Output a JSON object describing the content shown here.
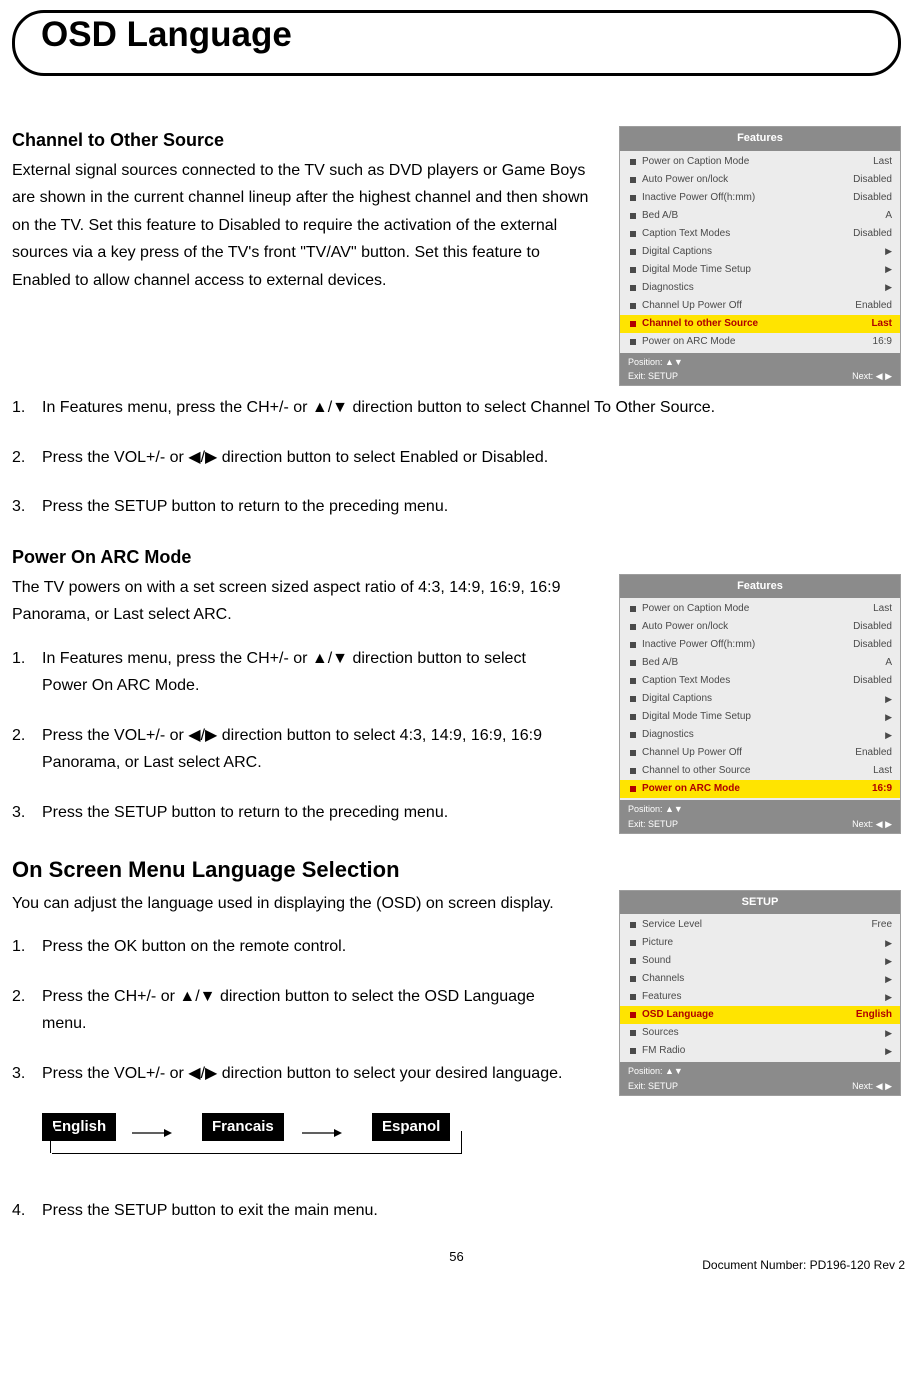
{
  "title": "OSD Language",
  "section1": {
    "heading": "Channel to Other Source",
    "para": "External signal sources connected to the TV such as DVD players or Game Boys are shown in the current channel lineup after the highest channel and then shown on the TV. Set this feature to Disabled to require the activation of the external sources via a key press of the TV's front \"TV/AV\" button. Set this feature to Enabled to allow channel access to external devices.",
    "steps": [
      "In Features menu, press the CH+/- or ▲/▼ direction button to select Channel To Other Source.",
      "Press the VOL+/- or ◀/▶ direction button to select Enabled or Disabled.",
      "Press the SETUP button to return to the preceding menu."
    ]
  },
  "section2": {
    "heading": "Power On ARC Mode",
    "para": "The TV powers on with a set screen sized aspect ratio of   4:3, 14:9, 16:9, 16:9 Panorama, or Last select ARC.",
    "steps": [
      "In Features menu, press the CH+/- or ▲/▼ direction button to select Power On ARC Mode.",
      "Press the VOL+/- or ◀/▶ direction button to select 4:3, 14:9, 16:9, 16:9 Panorama, or Last select ARC.",
      "Press the SETUP button to return to the preceding menu."
    ]
  },
  "section3": {
    "heading": "On Screen Menu Language Selection",
    "para": "You can adjust the language used in displaying the (OSD) on screen display.",
    "steps": [
      "Press the OK button on the remote control.",
      "Press the CH+/- or ▲/▼ direction button to select the OSD Language menu.",
      "Press the VOL+/- or ◀/▶ direction button to select your desired language.",
      "Press the SETUP button to exit the main menu."
    ]
  },
  "osd_features_1": {
    "header": "Features",
    "rows": [
      {
        "label": "Power on Caption Mode",
        "value": "Last",
        "hi": false
      },
      {
        "label": "Auto Power on/lock",
        "value": "Disabled",
        "hi": false
      },
      {
        "label": "Inactive Power Off(h:mm)",
        "value": "Disabled",
        "hi": false
      },
      {
        "label": "Bed A/B",
        "value": "A",
        "hi": false
      },
      {
        "label": "Caption Text Modes",
        "value": "Disabled",
        "hi": false
      },
      {
        "label": "Digital Captions",
        "value": "▶",
        "hi": false
      },
      {
        "label": "Digital Mode Time Setup",
        "value": "▶",
        "hi": false
      },
      {
        "label": "Diagnostics",
        "value": "▶",
        "hi": false
      },
      {
        "label": "Channel Up Power Off",
        "value": "Enabled",
        "hi": false
      },
      {
        "label": "Channel to other Source",
        "value": "Last",
        "hi": true
      },
      {
        "label": "Power on ARC Mode",
        "value": "16:9",
        "hi": false
      }
    ],
    "footer_pos": "Position: ▲▼",
    "footer_exit": "Exit: SETUP",
    "footer_next": "Next: ◀ ▶"
  },
  "osd_features_2": {
    "header": "Features",
    "rows": [
      {
        "label": "Power on Caption Mode",
        "value": "Last",
        "hi": false
      },
      {
        "label": "Auto Power on/lock",
        "value": "Disabled",
        "hi": false
      },
      {
        "label": "Inactive Power Off(h:mm)",
        "value": "Disabled",
        "hi": false
      },
      {
        "label": "Bed A/B",
        "value": "A",
        "hi": false
      },
      {
        "label": "Caption Text Modes",
        "value": "Disabled",
        "hi": false
      },
      {
        "label": "Digital Captions",
        "value": "▶",
        "hi": false
      },
      {
        "label": "Digital Mode Time Setup",
        "value": "▶",
        "hi": false
      },
      {
        "label": "Diagnostics",
        "value": "▶",
        "hi": false
      },
      {
        "label": "Channel Up Power Off",
        "value": "Enabled",
        "hi": false
      },
      {
        "label": "Channel to other Source",
        "value": "Last",
        "hi": false
      },
      {
        "label": "Power on ARC Mode",
        "value": "16:9",
        "hi": true
      }
    ],
    "footer_pos": "Position: ▲▼",
    "footer_exit": "Exit: SETUP",
    "footer_next": "Next: ◀ ▶"
  },
  "osd_setup": {
    "header": "SETUP",
    "rows": [
      {
        "label": "Service Level",
        "value": "Free",
        "hi": false
      },
      {
        "label": "Picture",
        "value": "▶",
        "hi": false
      },
      {
        "label": "Sound",
        "value": "▶",
        "hi": false
      },
      {
        "label": "Channels",
        "value": "▶",
        "hi": false
      },
      {
        "label": "Features",
        "value": "▶",
        "hi": false
      },
      {
        "label": "OSD Language",
        "value": "English",
        "hi": true
      },
      {
        "label": "Sources",
        "value": "▶",
        "hi": false
      },
      {
        "label": "FM Radio",
        "value": "▶",
        "hi": false
      }
    ],
    "footer_pos": "Position: ▲▼",
    "footer_exit": "Exit: SETUP",
    "footer_next": "Next: ◀ ▶"
  },
  "languages": {
    "a": "English",
    "b": "Francais",
    "c": "Espanol"
  },
  "page_number": "56",
  "doc_number": "Document Number: PD196-120 Rev 2"
}
